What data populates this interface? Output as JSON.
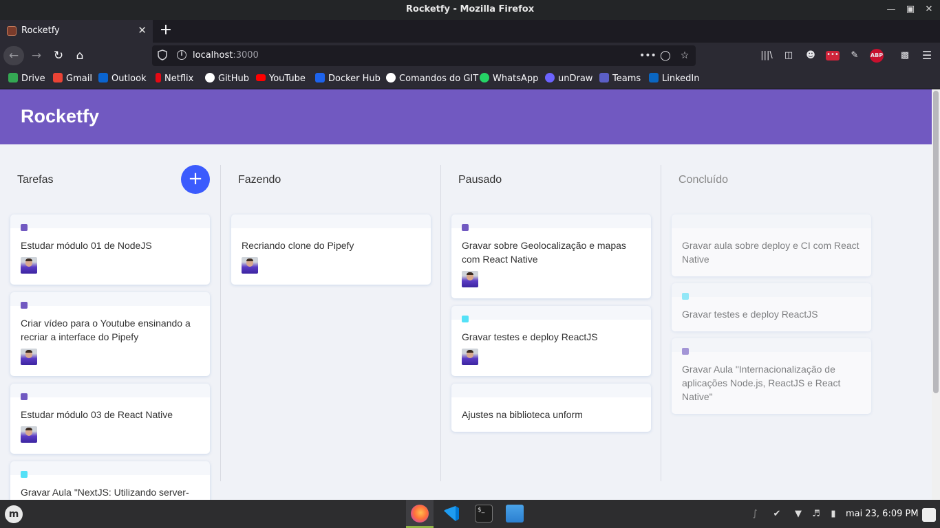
{
  "window": {
    "title": "Rocketfy - Mozilla Firefox"
  },
  "tab": {
    "label": "Rocketfy"
  },
  "urlbar": {
    "host": "localhost",
    "port": ":3000"
  },
  "bookmarks": [
    {
      "label": "Drive",
      "icon": "drive-icon",
      "color": "#34a853"
    },
    {
      "label": "Gmail",
      "icon": "gmail-icon",
      "color": "#ea4335"
    },
    {
      "label": "Outlook",
      "icon": "outlook-icon",
      "color": "#0a64d0"
    },
    {
      "label": "Netflix",
      "icon": "netflix-icon",
      "color": "#e50914"
    },
    {
      "label": "GitHub",
      "icon": "github-icon",
      "color": "#ffffff"
    },
    {
      "label": "YouTube",
      "icon": "youtube-icon",
      "color": "#ff0000"
    },
    {
      "label": "Docker Hub",
      "icon": "docker-icon",
      "color": "#1d63ed"
    },
    {
      "label": "Comandos do GIT",
      "icon": "github-icon",
      "color": "#ffffff"
    },
    {
      "label": "WhatsApp",
      "icon": "whatsapp-icon",
      "color": "#25d366"
    },
    {
      "label": "unDraw",
      "icon": "undraw-icon",
      "color": "#6c63ff"
    },
    {
      "label": "Teams",
      "icon": "teams-icon",
      "color": "#5b5fc7"
    },
    {
      "label": "LinkedIn",
      "icon": "linkedin-icon",
      "color": "#0a66c2"
    }
  ],
  "app": {
    "title": "Rocketfy",
    "accent": "#7159c1",
    "add_button": "+",
    "columns": [
      {
        "title": "Tarefas",
        "cards": [
          {
            "content": "Estudar módulo 01 de NodeJS",
            "label_color": "#7159c1",
            "has_avatar": true
          },
          {
            "content": "Criar vídeo para o Youtube ensinando a recriar a interface do Pipefy",
            "label_color": "#7159c1",
            "has_avatar": true
          },
          {
            "content": "Estudar módulo 03 de React Native",
            "label_color": "#7159c1",
            "has_avatar": true
          },
          {
            "content": "Gravar Aula \"NextJS: Utilizando server-",
            "label_color": "#54e1f7",
            "has_avatar": false
          }
        ]
      },
      {
        "title": "Fazendo",
        "cards": [
          {
            "content": "Recriando clone do Pipefy",
            "label_color": "",
            "has_avatar": true
          }
        ]
      },
      {
        "title": "Pausado",
        "cards": [
          {
            "content": "Gravar sobre Geolocalização e mapas com React Native",
            "label_color": "#7159c1",
            "has_avatar": true
          },
          {
            "content": "Gravar testes e deploy ReactJS",
            "label_color": "#54e1f7",
            "has_avatar": true
          },
          {
            "content": "Ajustes na biblioteca unform",
            "label_color": "",
            "has_avatar": false
          }
        ]
      },
      {
        "title": "Concluído",
        "cards": [
          {
            "content": "Gravar aula sobre deploy e CI com React Native",
            "label_color": "",
            "has_avatar": false
          },
          {
            "content": "Gravar testes e deploy ReactJS",
            "label_color": "#54e1f7",
            "has_avatar": false
          },
          {
            "content": "Gravar Aula \"Internacionalização de aplicações Node.js, ReactJS e React Native\"",
            "label_color": "#7159c1",
            "has_avatar": false
          }
        ]
      }
    ]
  },
  "taskbar": {
    "apps": [
      {
        "name": "firefox-icon",
        "active": true
      },
      {
        "name": "vscode-icon",
        "active": false
      },
      {
        "name": "terminal-icon",
        "active": false
      },
      {
        "name": "files-icon",
        "active": false
      }
    ],
    "clock": "mai 23,  6:09 PM"
  }
}
